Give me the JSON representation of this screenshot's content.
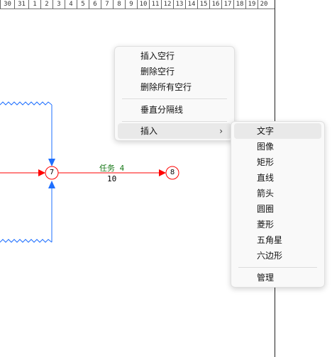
{
  "ruler": {
    "ticks": [
      "30",
      "31",
      "1",
      "2",
      "3",
      "4",
      "5",
      "6",
      "7",
      "8",
      "9",
      "10",
      "11",
      "12",
      "13",
      "14",
      "15",
      "16",
      "17",
      "18",
      "19",
      "20"
    ]
  },
  "diagram": {
    "nodes": [
      {
        "id": "node-7",
        "label": "7"
      },
      {
        "id": "node-8",
        "label": "8"
      }
    ],
    "task": {
      "name": "任务 4",
      "duration": "10"
    },
    "colors": {
      "activity": "#ff0000",
      "dependency": "#1e6fff",
      "task_text": "#1a7a1a"
    }
  },
  "context_menu": {
    "items": [
      "插入空行",
      "删除空行",
      "删除所有空行",
      "垂直分隔线",
      "插入"
    ],
    "submenu_arrow": "›"
  },
  "submenu": {
    "items": [
      "文字",
      "图像",
      "矩形",
      "直线",
      "箭头",
      "圆圈",
      "菱形",
      "五角星",
      "六边形",
      "管理"
    ]
  }
}
